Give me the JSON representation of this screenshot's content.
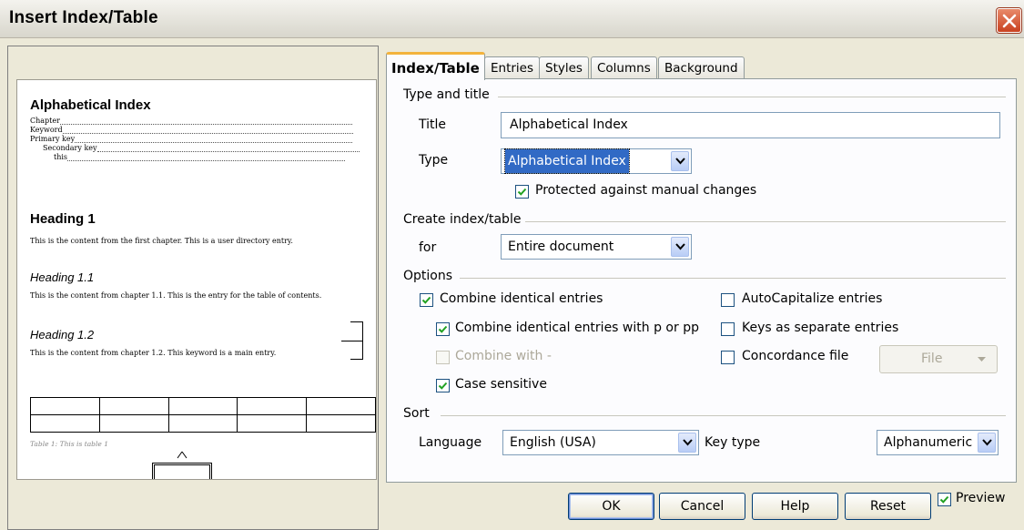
{
  "window": {
    "title": "Insert Index/Table"
  },
  "preview": {
    "index_title": "Alphabetical Index",
    "entries": [
      "Chapter",
      "Keyword",
      "Primary key",
      "Secondary key",
      "this"
    ],
    "heading1": "Heading 1",
    "heading1_body": "This is the content from the first chapter. This is a user directory entry.",
    "heading11": "Heading 1.1",
    "heading11_body": "This is the content from chapter 1.1. This is the entry for the table of contents.",
    "heading12": "Heading 1.2",
    "heading12_body": "This is the content from chapter 1.2. This keyword is a main entry.",
    "table_caption": "Table 1: This is table 1"
  },
  "tabs": [
    {
      "label": "Index/Table",
      "active": true
    },
    {
      "label": "Entries"
    },
    {
      "label": "Styles"
    },
    {
      "label": "Columns"
    },
    {
      "label": "Background"
    }
  ],
  "type_and_title": {
    "section": "Type and title",
    "title_label": "Title",
    "title_value": "Alphabetical Index",
    "type_label": "Type",
    "type_value": "Alphabetical Index",
    "protected_label": "Protected against manual changes",
    "protected_checked": true
  },
  "create": {
    "section": "Create index/table",
    "for_label": "for",
    "for_value": "Entire document"
  },
  "options": {
    "section": "Options",
    "combine_identical": {
      "label": "Combine identical entries",
      "checked": true
    },
    "combine_p_pp": {
      "label": "Combine identical entries with p or pp",
      "checked": true
    },
    "combine_with": {
      "label": "Combine with -",
      "checked": false,
      "disabled": true
    },
    "case_sensitive": {
      "label": "Case sensitive",
      "checked": true
    },
    "autocapitalize": {
      "label": "AutoCapitalize entries",
      "checked": false
    },
    "keys_separate": {
      "label": "Keys as separate entries",
      "checked": false
    },
    "concordance": {
      "label": "Concordance file",
      "checked": false
    },
    "file_button": "File"
  },
  "sort": {
    "section": "Sort",
    "language_label": "Language",
    "language_value": "English (USA)",
    "key_type_label": "Key type",
    "key_type_value": "Alphanumeric"
  },
  "buttons": {
    "ok": "OK",
    "cancel": "Cancel",
    "help": "Help",
    "reset": "Reset",
    "preview": {
      "label": "Preview",
      "checked": true
    }
  },
  "colors": {
    "accent": "#316ac5",
    "tab_highlight": "#f3b33d",
    "close": "#c9411f"
  }
}
